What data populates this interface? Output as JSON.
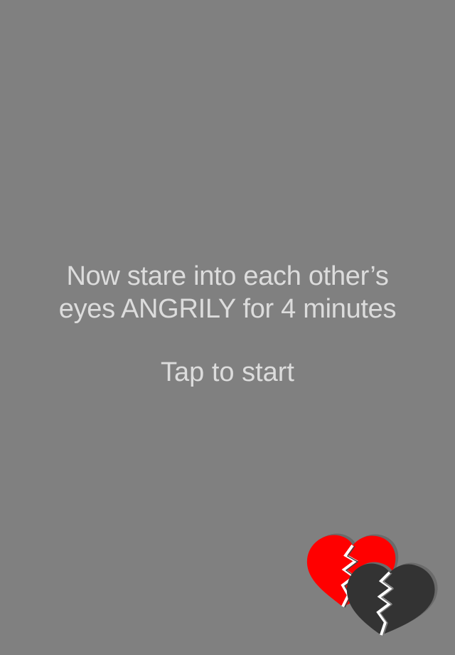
{
  "prompt": {
    "line1": "Now stare into each other’s",
    "line2": "eyes ANGRILY for 4 minutes"
  },
  "action": {
    "tap_label": "Tap to start"
  },
  "logo": {
    "icon": "broken-hearts-icon",
    "colors": {
      "red_heart": "#ff0000",
      "dark_heart": "#333333",
      "crack": "#ffffff",
      "background": "#808080",
      "text": "#dcdcdc"
    }
  }
}
